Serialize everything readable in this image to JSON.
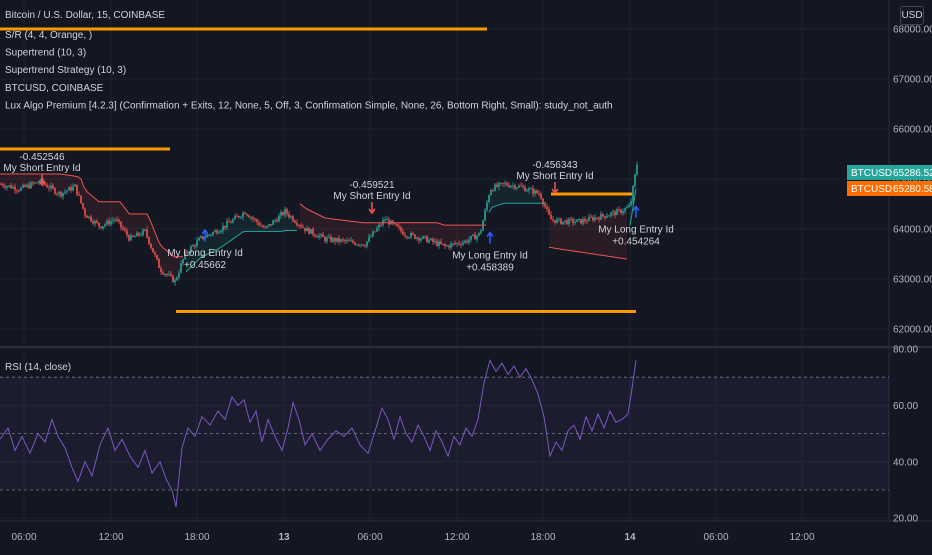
{
  "header": {
    "title": "Bitcoin / U.S. Dollar, 15, COINBASE",
    "indicators": [
      "S/R (4, 4, Orange, )",
      "Supertrend (10, 3)",
      "Supertrend Strategy (10, 3)",
      "BTCUSD, COINBASE",
      "Lux Algo Premium [4.2.3] (Confirmation + Exits, 12, None, 5, Off, 3, Confirmation Simple, None, 26, Bottom Right, Small): study_not_auth"
    ],
    "currency_button": "USD"
  },
  "colors": {
    "background": "#131722",
    "up_candle": "#26a69a",
    "down_candle": "#ef5350",
    "sr_line": "#ff9800",
    "supertrend_down": "#ef5350",
    "supertrend_up": "#26a69a",
    "rsi_line": "#7e57c2",
    "short_arrow": "#ef5350",
    "long_arrow": "#2962ff"
  },
  "chart_data": [
    {
      "type": "candlestick",
      "title": "Bitcoin / U.S. Dollar, 15, COINBASE",
      "x_ticks": [
        "06:00",
        "12:00",
        "18:00",
        "13",
        "06:00",
        "12:00",
        "18:00",
        "14",
        "06:00",
        "12:00"
      ],
      "y_ticks": [
        62000.0,
        63000.0,
        64000.0,
        65000.0,
        66000.0,
        67000.0,
        68000.0
      ],
      "y_tick_labels": [
        "62000.00",
        "63000.00",
        "64000.00",
        "65000.00",
        "66000.00",
        "67000.00",
        "68000.00"
      ],
      "ylim": [
        61700,
        68300
      ],
      "price_path_approx": [
        [
          0,
          64900
        ],
        [
          20,
          64800
        ],
        [
          40,
          64950
        ],
        [
          60,
          64700
        ],
        [
          75,
          64850
        ],
        [
          85,
          64300
        ],
        [
          100,
          64050
        ],
        [
          115,
          64200
        ],
        [
          130,
          63800
        ],
        [
          145,
          63950
        ],
        [
          160,
          63200
        ],
        [
          175,
          62950
        ],
        [
          185,
          63500
        ],
        [
          200,
          63800
        ],
        [
          220,
          64000
        ],
        [
          245,
          64350
        ],
        [
          265,
          64000
        ],
        [
          285,
          64350
        ],
        [
          305,
          64000
        ],
        [
          325,
          63800
        ],
        [
          345,
          63750
        ],
        [
          365,
          63700
        ],
        [
          385,
          64200
        ],
        [
          405,
          63900
        ],
        [
          425,
          63800
        ],
        [
          445,
          63650
        ],
        [
          465,
          63750
        ],
        [
          480,
          63900
        ],
        [
          490,
          64800
        ],
        [
          505,
          64900
        ],
        [
          520,
          64850
        ],
        [
          540,
          64700
        ],
        [
          550,
          64200
        ],
        [
          560,
          64150
        ],
        [
          580,
          64150
        ],
        [
          600,
          64250
        ],
        [
          620,
          64350
        ],
        [
          630,
          64450
        ],
        [
          637,
          65300
        ]
      ],
      "sr_levels": [
        {
          "value": 68000,
          "x_from": 0,
          "x_to": 487
        },
        {
          "value": 65600,
          "x_from": 0,
          "x_to": 170
        },
        {
          "value": 64700,
          "x_from": 551,
          "x_to": 632
        },
        {
          "value": 62350,
          "x_from": 176,
          "x_to": 636
        }
      ],
      "price_labels": [
        {
          "symbol": "BTCUSD",
          "value": "65286.52",
          "color": "#26a69a"
        },
        {
          "symbol": "BTCUSD",
          "value": "65280.58",
          "color": "#ff6d00"
        }
      ],
      "signals": [
        {
          "type": "short",
          "label": "My Short Entry Id",
          "value": "-0.452546",
          "x": 42,
          "y": 64980
        },
        {
          "type": "short",
          "label": "My Short Entry Id",
          "value": "-0.459521",
          "x": 372,
          "y": 64420
        },
        {
          "type": "short",
          "label": "My Short Entry Id",
          "value": "-0.456343",
          "x": 555,
          "y": 64820
        },
        {
          "type": "long",
          "label": "My Long Entry Id",
          "value": "+0.45662",
          "x": 205,
          "y": 63880
        },
        {
          "type": "long",
          "label": "My Long Entry Id",
          "value": "+0.458389",
          "x": 490,
          "y": 63830
        },
        {
          "type": "long",
          "label": "My Long Entry Id",
          "value": "+0.454264",
          "x": 636,
          "y": 64350
        }
      ]
    },
    {
      "type": "line",
      "title": "RSI (14, close)",
      "y_ticks": [
        20.0,
        40.0,
        60.0,
        80.0
      ],
      "y_tick_labels": [
        "20.00",
        "40.00",
        "60.00",
        "80.00"
      ],
      "ylim": [
        19,
        80
      ],
      "bands": [
        70,
        50,
        30
      ],
      "series": [
        {
          "name": "RSI (14, close)",
          "points": [
            [
              0,
              48
            ],
            [
              8,
              52
            ],
            [
              15,
              44
            ],
            [
              22,
              49
            ],
            [
              30,
              43
            ],
            [
              38,
              50
            ],
            [
              45,
              47
            ],
            [
              52,
              55
            ],
            [
              58,
              49
            ],
            [
              65,
              45
            ],
            [
              72,
              38
            ],
            [
              78,
              33
            ],
            [
              85,
              40
            ],
            [
              92,
              35
            ],
            [
              100,
              46
            ],
            [
              108,
              52
            ],
            [
              115,
              44
            ],
            [
              122,
              48
            ],
            [
              130,
              42
            ],
            [
              138,
              38
            ],
            [
              145,
              44
            ],
            [
              152,
              36
            ],
            [
              160,
              40
            ],
            [
              166,
              34
            ],
            [
              172,
              30
            ],
            [
              176,
              24
            ],
            [
              182,
              45
            ],
            [
              188,
              52
            ],
            [
              195,
              49
            ],
            [
              202,
              56
            ],
            [
              210,
              53
            ],
            [
              218,
              58
            ],
            [
              225,
              55
            ],
            [
              232,
              63
            ],
            [
              238,
              60
            ],
            [
              244,
              62
            ],
            [
              250,
              54
            ],
            [
              256,
              58
            ],
            [
              262,
              47
            ],
            [
              268,
              55
            ],
            [
              275,
              49
            ],
            [
              282,
              44
            ],
            [
              288,
              52
            ],
            [
              293,
              61
            ],
            [
              299,
              55
            ],
            [
              305,
              46
            ],
            [
              312,
              50
            ],
            [
              320,
              44
            ],
            [
              328,
              48
            ],
            [
              336,
              51
            ],
            [
              344,
              49
            ],
            [
              352,
              52
            ],
            [
              360,
              46
            ],
            [
              368,
              43
            ],
            [
              376,
              52
            ],
            [
              382,
              59
            ],
            [
              388,
              55
            ],
            [
              394,
              48
            ],
            [
              400,
              56
            ],
            [
              406,
              50
            ],
            [
              412,
              47
            ],
            [
              418,
              53
            ],
            [
              424,
              49
            ],
            [
              430,
              44
            ],
            [
              436,
              51
            ],
            [
              442,
              47
            ],
            [
              448,
              42
            ],
            [
              454,
              49
            ],
            [
              460,
              46
            ],
            [
              466,
              52
            ],
            [
              472,
              49
            ],
            [
              478,
              55
            ],
            [
              484,
              68
            ],
            [
              490,
              76
            ],
            [
              496,
              72
            ],
            [
              502,
              75
            ],
            [
              508,
              71
            ],
            [
              514,
              74
            ],
            [
              520,
              70
            ],
            [
              526,
              73
            ],
            [
              532,
              69
            ],
            [
              538,
              64
            ],
            [
              544,
              56
            ],
            [
              550,
              42
            ],
            [
              556,
              47
            ],
            [
              562,
              44
            ],
            [
              568,
              51
            ],
            [
              574,
              53
            ],
            [
              580,
              48
            ],
            [
              586,
              56
            ],
            [
              592,
              51
            ],
            [
              598,
              57
            ],
            [
              604,
              52
            ],
            [
              610,
              58
            ],
            [
              616,
              54
            ],
            [
              622,
              55
            ],
            [
              628,
              57
            ],
            [
              632,
              66
            ],
            [
              636,
              76
            ]
          ]
        }
      ]
    }
  ]
}
